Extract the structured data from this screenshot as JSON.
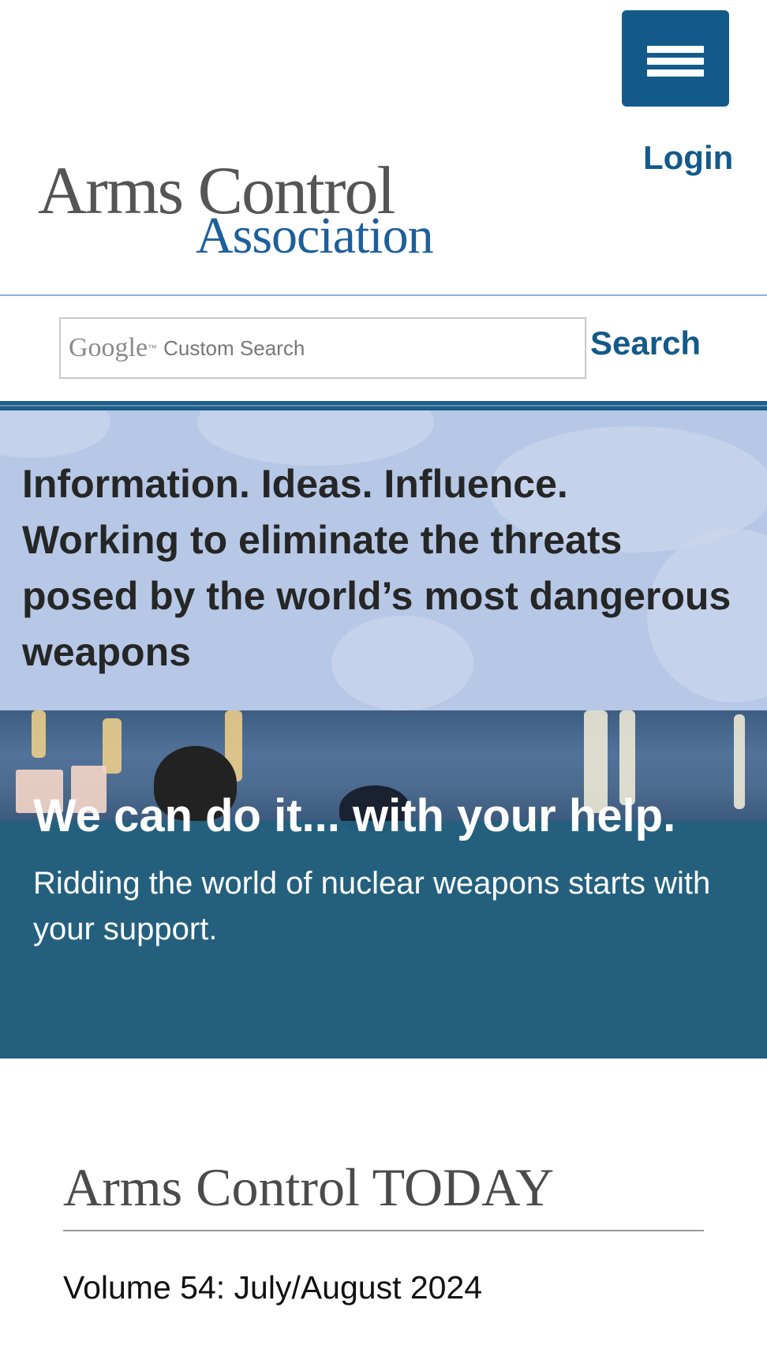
{
  "header": {
    "menu_icon": "hamburger-menu-icon",
    "login_label": "Login",
    "brand_color": "#135a8a"
  },
  "logo": {
    "line1": "Arms Control",
    "line2": "Association"
  },
  "search": {
    "google_label": "Google",
    "trademark": "™",
    "placeholder": "Custom Search",
    "button_label": "Search"
  },
  "tagline": {
    "text": "Information. Ideas. Influence. Working to eliminate the threats posed by the world’s most dangerous weapons"
  },
  "support_banner": {
    "headline": "We can do it... with your help.",
    "body": "Ridding the world of nuclear weapons starts with your support."
  },
  "arms_control_today": {
    "title": "Arms Control TODAY",
    "volume": "Volume 54: July/August 2024"
  }
}
